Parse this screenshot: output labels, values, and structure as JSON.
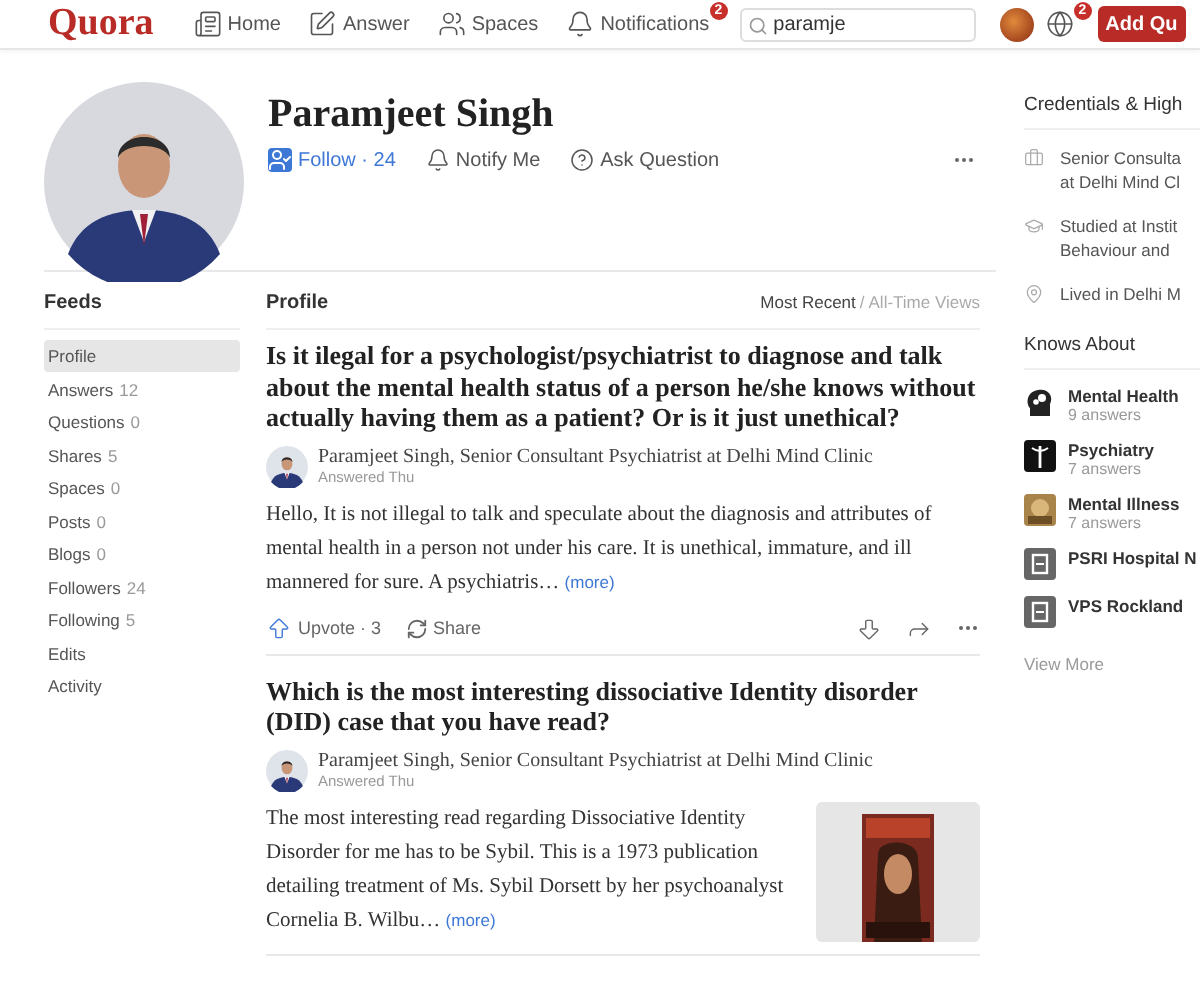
{
  "nav": {
    "logo": "Quora",
    "items": [
      {
        "label": "Home",
        "kind": "home"
      },
      {
        "label": "Answer",
        "kind": "answer"
      },
      {
        "label": "Spaces",
        "kind": "spaces"
      },
      {
        "label": "Notifications",
        "kind": "bell",
        "badge": "2"
      }
    ],
    "search": {
      "value": "paramje"
    },
    "globe_badge": "2",
    "add_button": "Add Qu"
  },
  "profile": {
    "name": "Paramjeet Singh",
    "follow": "Follow · 24",
    "actions": [
      {
        "label": "Notify Me",
        "kind": "bell"
      },
      {
        "label": "Ask Question",
        "kind": "ask"
      }
    ]
  },
  "feeds": {
    "title": "Feeds",
    "items": [
      {
        "label": "Profile",
        "selected": true
      },
      {
        "label": "Answers",
        "count": "12",
        "selected": false
      },
      {
        "label": "Questions",
        "count": "0",
        "selected": false
      },
      {
        "label": "Shares",
        "count": "5",
        "selected": false
      },
      {
        "label": "Spaces",
        "count": "0",
        "selected": false
      },
      {
        "label": "Posts",
        "count": "0",
        "selected": false
      },
      {
        "label": "Blogs",
        "count": "0",
        "selected": false
      },
      {
        "label": "Followers",
        "count": "24",
        "selected": false
      },
      {
        "label": "Following",
        "count": "5",
        "selected": false
      },
      {
        "label": "Edits",
        "selected": false
      },
      {
        "label": "Activity",
        "selected": false
      }
    ]
  },
  "main": {
    "title": "Profile",
    "sort": [
      {
        "label": "Most Recent",
        "selected": true
      },
      {
        "label": "All-Time Views",
        "selected": false
      }
    ],
    "sort_separator": "/",
    "answers": [
      {
        "question": "Is it ilegal for a psychologist/psychiatrist to diagnose and talk about the mental health status of a person he/she knows without actually having them as a patient? Or is it just unethical?",
        "author": "Paramjeet Singh, Senior Consultant Psychiatrist at Delhi Mind Clinic",
        "time": "Answered Thu",
        "body": "Hello, It is not illegal to talk and speculate about the diagnosis and attributes of mental health in a person not under his care. It is unethical, immature, and ill mannered for sure. A psychiatris…",
        "more": "(more)",
        "upvote": "Upvote · 3",
        "share": "Share"
      },
      {
        "question": "Which is the most interesting dissociative Identity disorder (DID) case that you have read?",
        "author": "Paramjeet Singh, Senior Consultant Psychiatrist at Delhi Mind Clinic",
        "time": "Answered Thu",
        "body": "The most interesting read regarding Dissociative Identity Disorder for me has to be Sybil. This is a 1973 publication detailing treatment of Ms. Sybil Dorsett by her psychoanalyst Cornelia B. Wilbu…",
        "more": "(more)",
        "kind": "picture"
      }
    ]
  },
  "credentials": {
    "title": "Credentials & High",
    "items": [
      {
        "kind": "work",
        "lines": [
          "Senior Consulta",
          "at Delhi Mind Cl"
        ]
      },
      {
        "kind": "study",
        "lines": [
          "Studied at Instit",
          "Behaviour and"
        ]
      },
      {
        "kind": "place",
        "lines": [
          "Lived in Delhi M"
        ]
      }
    ]
  },
  "knows_about": {
    "title": "Knows About",
    "topics": [
      {
        "name": "Mental Health",
        "answers": "9 answers",
        "kind": "head"
      },
      {
        "name": "Psychiatry",
        "answers": "7 answers",
        "kind": "staff"
      },
      {
        "name": "Mental Illness",
        "answers": "7 answers",
        "kind": "picture"
      },
      {
        "name": "PSRI Hospital N",
        "kind": "doc"
      },
      {
        "name": "VPS Rockland",
        "kind": "doc"
      }
    ],
    "view_more": "View More"
  }
}
